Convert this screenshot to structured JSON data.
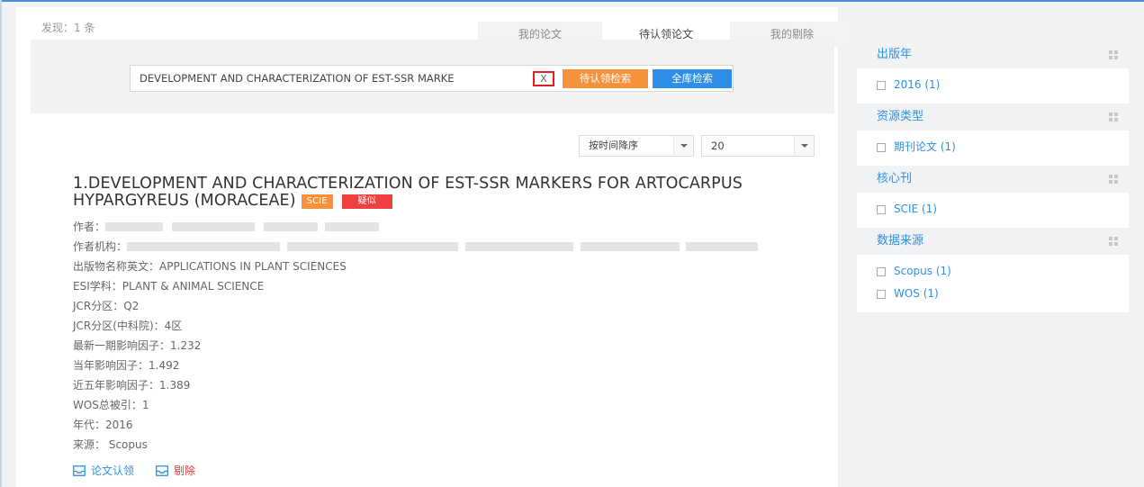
{
  "header": {
    "found_label": "发现：1 条"
  },
  "tabs": [
    {
      "label": "我的论文"
    },
    {
      "label": "待认领论文"
    },
    {
      "label": "我的剔除"
    }
  ],
  "search": {
    "query": "DEVELOPMENT AND CHARACTERIZATION OF EST-SSR MARKE",
    "clear_label": "X",
    "pending_search_label": "待认领检索",
    "all_search_label": "全库检索"
  },
  "sort": {
    "selected": "按时间降序"
  },
  "page_size": {
    "selected": "20"
  },
  "result": {
    "title": "1.DEVELOPMENT AND CHARACTERIZATION OF EST-SSR MARKERS FOR ARTOCARPUS HYPARGYREUS (MORACEAE)",
    "badge_scie": "SCIE",
    "badge_similar": "疑似",
    "author_label": "作者：",
    "affiliation_label": "作者机构：",
    "fields": [
      {
        "label": "出版物名称英文：",
        "value": "APPLICATIONS IN PLANT SCIENCES"
      },
      {
        "label": "ESI学科：",
        "value": "PLANT & ANIMAL SCIENCE"
      },
      {
        "label": "JCR分区：",
        "value": "Q2"
      },
      {
        "label": "JCR分区(中科院)：",
        "value": "4区"
      },
      {
        "label": "最新一期影响因子：",
        "value": "1.232"
      },
      {
        "label": "当年影响因子：",
        "value": "1.492"
      },
      {
        "label": "近五年影响因子：",
        "value": "1.389"
      },
      {
        "label": "WOS总被引：",
        "value": "1"
      },
      {
        "label": "年代：",
        "value": "2016"
      },
      {
        "label": "来源：",
        "value": " Scopus"
      }
    ],
    "claim_label": "论文认领",
    "remove_label": "剔除"
  },
  "facets": [
    {
      "title": "出版年",
      "items": [
        {
          "label": "2016 (1)"
        }
      ]
    },
    {
      "title": "资源类型",
      "items": [
        {
          "label": "期刊论文 (1)"
        }
      ]
    },
    {
      "title": "核心刊",
      "items": [
        {
          "label": "SCIE (1)"
        }
      ]
    },
    {
      "title": "数据来源",
      "items": [
        {
          "label": "Scopus (1)"
        },
        {
          "label": "WOS (1)"
        }
      ]
    }
  ],
  "colors": {
    "accent": "#2f8fe8",
    "orange": "#f7923a",
    "red": "#ef4040"
  }
}
